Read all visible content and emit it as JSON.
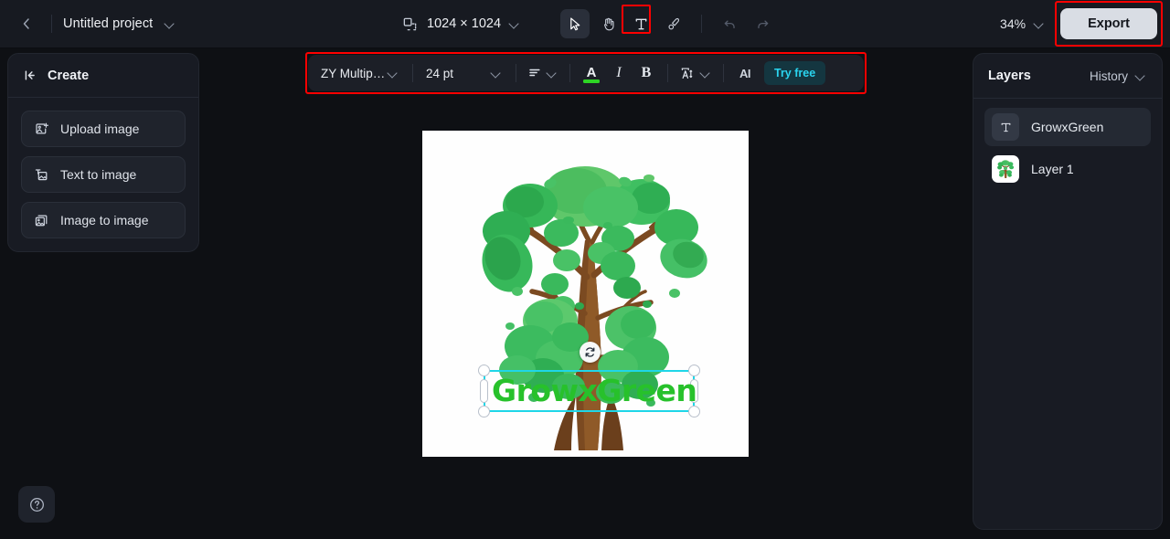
{
  "topbar": {
    "back_icon": "chevron-left-icon",
    "project_title": "Untitled project",
    "canvas_size": "1024 × 1024",
    "canvas_size_icon": "resize-canvas-icon",
    "zoom_level": "34%",
    "export_label": "Export",
    "tools": [
      {
        "name": "select-tool",
        "icon": "cursor-icon",
        "active": true
      },
      {
        "name": "hand-tool",
        "icon": "hand-icon",
        "active": false
      },
      {
        "name": "text-tool",
        "icon": "text-t-icon",
        "active": false,
        "highlighted": true
      },
      {
        "name": "brush-tool",
        "icon": "brush-icon",
        "active": false
      },
      {
        "name": "undo",
        "icon": "undo-arrow-icon",
        "active": false,
        "disabled": true
      },
      {
        "name": "redo",
        "icon": "redo-arrow-icon",
        "active": false,
        "disabled": true
      }
    ]
  },
  "left_panel": {
    "collapse_icon": "collapse-panel-icon",
    "title": "Create",
    "items": [
      {
        "label": "Upload image",
        "icon": "upload-image-icon"
      },
      {
        "label": "Text to image",
        "icon": "text-to-image-icon"
      },
      {
        "label": "Image to image",
        "icon": "image-to-image-icon"
      }
    ],
    "help_icon": "question-circle-icon"
  },
  "text_toolbar": {
    "font_family": "ZY Multip…",
    "font_size": "24 pt",
    "align_icon": "text-align-icon",
    "text_color_label": "A",
    "text_color": "#2dd424",
    "italic_label": "I",
    "bold_label": "B",
    "line_height_icon": "line-height-icon",
    "ai_label": "AI",
    "try_free_label": "Try free",
    "try_free_color": "#2ad4ef"
  },
  "canvas": {
    "text_layer_value": "GrowxGreen",
    "text_layer_color": "#27c12b",
    "rotate_icon": "rotate-icon",
    "selection_color": "#1fd6e8"
  },
  "right_panel": {
    "title": "Layers",
    "history_label": "History",
    "layers": [
      {
        "name": "GrowxGreen",
        "type": "text",
        "icon": "text-t-icon",
        "selected": true
      },
      {
        "name": "Layer 1",
        "type": "image",
        "icon": "tree-thumbnail",
        "selected": false
      }
    ]
  }
}
